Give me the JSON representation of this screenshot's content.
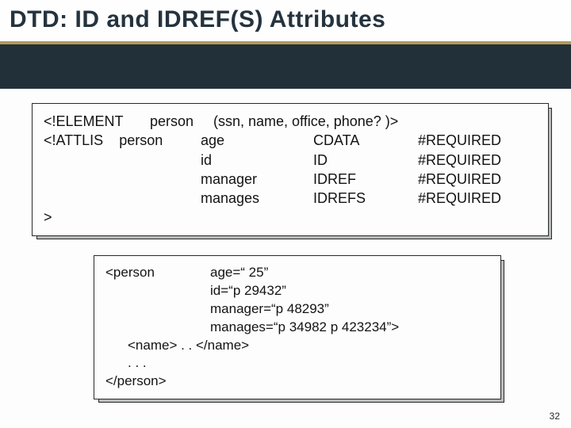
{
  "header": {
    "title": "DTD: ID and IDREF(S) Attributes"
  },
  "dtd": {
    "element_decl_keyword": "<!ELEMENT",
    "element_name": "person",
    "element_content": "(ssn, name, office, phone? )>",
    "attlist_keyword": "<!ATTLIS",
    "attlist_element": "person",
    "attrs": [
      {
        "name": "age",
        "type": "CDATA",
        "default": "#REQUIRED"
      },
      {
        "name": "id",
        "type": "ID",
        "default": "#REQUIRED"
      },
      {
        "name": "manager",
        "type": "IDREF",
        "default": "#REQUIRED"
      },
      {
        "name": "manages",
        "type": "IDREFS",
        "default": "#REQUIRED"
      }
    ],
    "close": ">"
  },
  "example": {
    "open_tag": "<person",
    "attrs": [
      {
        "line": "age=“ 25”"
      },
      {
        "line": "id=“p 29432”"
      },
      {
        "line": "manager=“p 48293”"
      },
      {
        "line": "manages=“p 34982 p 423234”>"
      }
    ],
    "body1": "<name> . . </name>",
    "body2": ". . .",
    "close": "</person>"
  },
  "slide_number": "32"
}
